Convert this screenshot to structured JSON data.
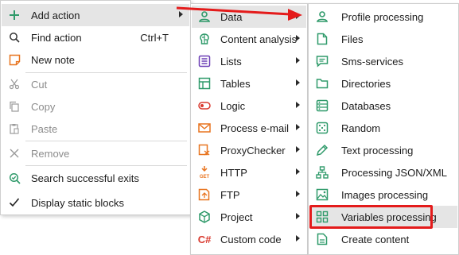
{
  "main_menu": {
    "add_action": "Add action",
    "find_action": "Find action",
    "find_shortcut": "Ctrl+T",
    "new_note": "New note",
    "cut": "Cut",
    "copy": "Copy",
    "paste": "Paste",
    "remove": "Remove",
    "search_exits": "Search successful exits",
    "display_static": "Display static blocks"
  },
  "category_menu": {
    "items": [
      {
        "label": "Data",
        "icon": "data-icon"
      },
      {
        "label": "Content analysis",
        "icon": "brain-icon"
      },
      {
        "label": "Lists",
        "icon": "list-icon"
      },
      {
        "label": "Tables",
        "icon": "table-icon"
      },
      {
        "label": "Logic",
        "icon": "toggle-icon"
      },
      {
        "label": "Process e-mail",
        "icon": "mail-icon"
      },
      {
        "label": "ProxyChecker",
        "icon": "proxy-icon"
      },
      {
        "label": "HTTP",
        "icon": "http-get-icon"
      },
      {
        "label": "FTP",
        "icon": "ftp-icon"
      },
      {
        "label": "Project",
        "icon": "cube-icon"
      },
      {
        "label": "Custom code",
        "icon": "csharp-icon"
      }
    ],
    "csharp_glyph": "C#"
  },
  "data_menu": {
    "items": [
      {
        "label": "Profile processing",
        "icon": "profile-icon"
      },
      {
        "label": "Files",
        "icon": "file-icon"
      },
      {
        "label": "Sms-services",
        "icon": "sms-icon"
      },
      {
        "label": "Directories",
        "icon": "folder-icon"
      },
      {
        "label": "Databases",
        "icon": "database-icon"
      },
      {
        "label": "Random",
        "icon": "dice-icon"
      },
      {
        "label": "Text processing",
        "icon": "pencil-icon"
      },
      {
        "label": "Processing JSON/XML",
        "icon": "tree-icon"
      },
      {
        "label": "Images processing",
        "icon": "image-icon"
      },
      {
        "label": "Variables processing",
        "icon": "variables-icon"
      },
      {
        "label": "Create content",
        "icon": "document-icon"
      }
    ]
  },
  "colors": {
    "accent_green": "#2f9a6a",
    "highlight_red": "#e41b1b",
    "hover_gray": "#e5e5e5"
  }
}
